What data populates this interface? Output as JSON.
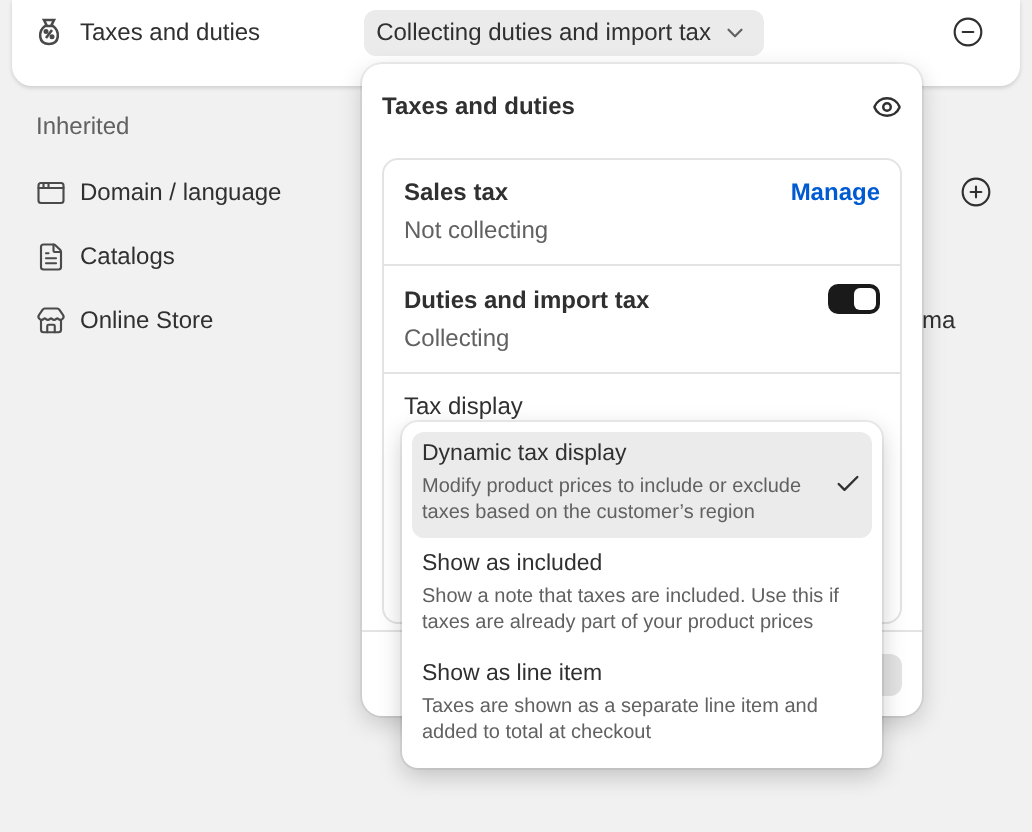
{
  "top_row": {
    "label": "Taxes and duties",
    "dropdown": "Collecting duties and import tax"
  },
  "inherited": {
    "heading": "Inherited",
    "items": [
      {
        "label": "Domain / language",
        "kind": "domain",
        "addable": true
      },
      {
        "label": "Catalogs",
        "kind": "catalog",
        "addable": false
      },
      {
        "label": "Online Store",
        "kind": "store",
        "addable": false,
        "trailing": "ma"
      }
    ]
  },
  "popover": {
    "title": "Taxes and duties",
    "sections": [
      {
        "kind": "link",
        "title": "Sales tax",
        "status": "Not collecting",
        "action": "Manage"
      },
      {
        "kind": "toggle",
        "title": "Duties and import tax",
        "status": "Collecting",
        "on": true
      }
    ],
    "tax_display_label": "Tax display"
  },
  "options": [
    {
      "title": "Dynamic tax display",
      "description": "Modify product prices to include or exclude taxes based on the customer’s region",
      "selected": true
    },
    {
      "title": "Show as included",
      "description": "Show a note that taxes are included. Use this if taxes are already part of your product prices",
      "selected": false
    },
    {
      "title": "Show as line item",
      "description": "Taxes are shown as a separate line item and added to total at checkout",
      "selected": false
    }
  ]
}
